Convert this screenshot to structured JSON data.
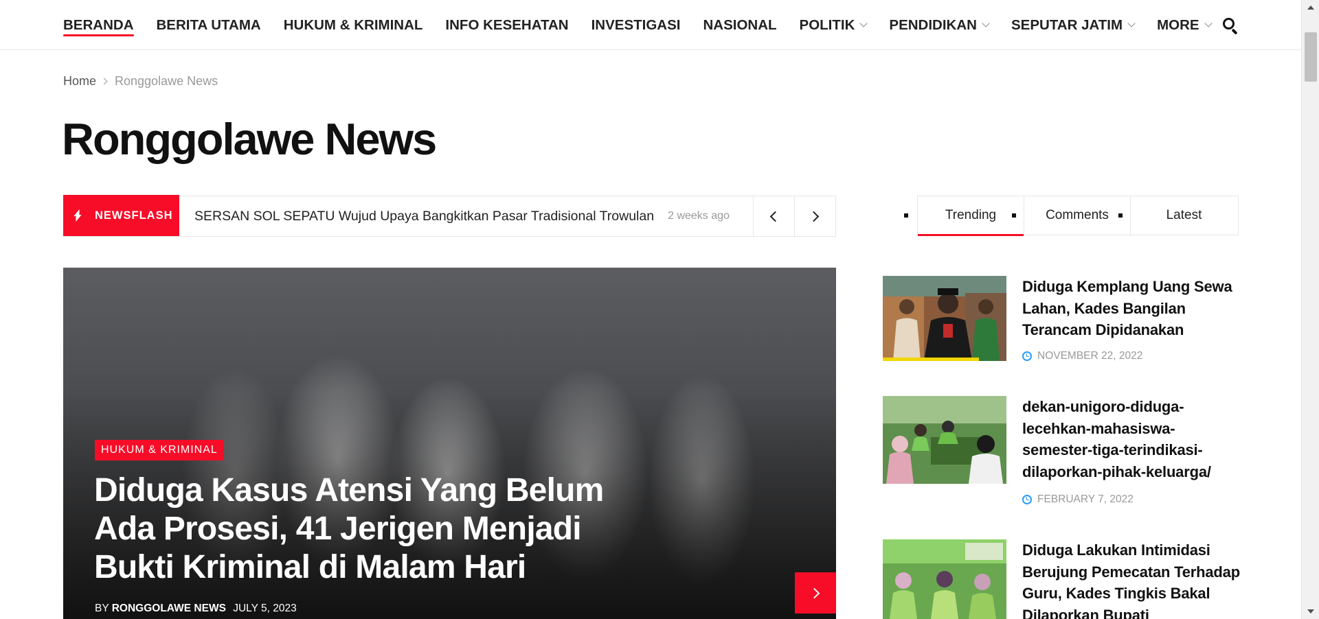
{
  "nav": {
    "items": [
      {
        "label": "BERANDA",
        "dropdown": false,
        "active": true
      },
      {
        "label": "BERITA UTAMA",
        "dropdown": false
      },
      {
        "label": "HUKUM & KRIMINAL",
        "dropdown": false
      },
      {
        "label": "INFO KESEHATAN",
        "dropdown": false
      },
      {
        "label": "INVESTIGASI",
        "dropdown": false
      },
      {
        "label": "NASIONAL",
        "dropdown": false
      },
      {
        "label": "POLITIK",
        "dropdown": true
      },
      {
        "label": "PENDIDIKAN",
        "dropdown": true
      },
      {
        "label": "SEPUTAR JATIM",
        "dropdown": true
      },
      {
        "label": "MORE",
        "dropdown": true
      }
    ],
    "search_icon": "search-icon"
  },
  "breadcrumb": {
    "home": "Home",
    "current": "Ronggolawe News"
  },
  "page_title": "Ronggolawe News",
  "newsflash": {
    "label": "NEWSFLASH",
    "headline": "SERSAN SOL SEPATU Wujud Upaya Bangkitkan Pasar Tradisional Trowulan",
    "time": "2 weeks ago"
  },
  "hero": {
    "category": "HUKUM & KRIMINAL",
    "title": "Diduga Kasus Atensi Yang Belum Ada Prosesi, 41 Jerigen Menjadi Bukti Kriminal di Malam Hari",
    "by": "BY",
    "author": "RONGGOLAWE NEWS",
    "date": "JULY 5, 2023"
  },
  "sidebar": {
    "tabs": [
      {
        "label": "Trending",
        "active": true
      },
      {
        "label": "Comments"
      },
      {
        "label": "Latest"
      }
    ],
    "posts": [
      {
        "title": "Diduga Kemplang Uang Sewa Lahan, Kades Bangilan Terancam Dipidanakan",
        "date": "NOVEMBER 22, 2022"
      },
      {
        "title": "dekan-unigoro-diduga-lecehkan-mahasiswa-semester-tiga-terindikasi-dilaporkan-pihak-keluarga/",
        "date": "FEBRUARY 7, 2022"
      },
      {
        "title": "Diduga Lakukan Intimidasi Berujung Pemecatan Terhadap Guru, Kades Tingkis Bakal Dilaporkan Bupati",
        "date": ""
      }
    ]
  },
  "colors": {
    "accent": "#f70d28",
    "date_icon": "#2a9df4"
  }
}
